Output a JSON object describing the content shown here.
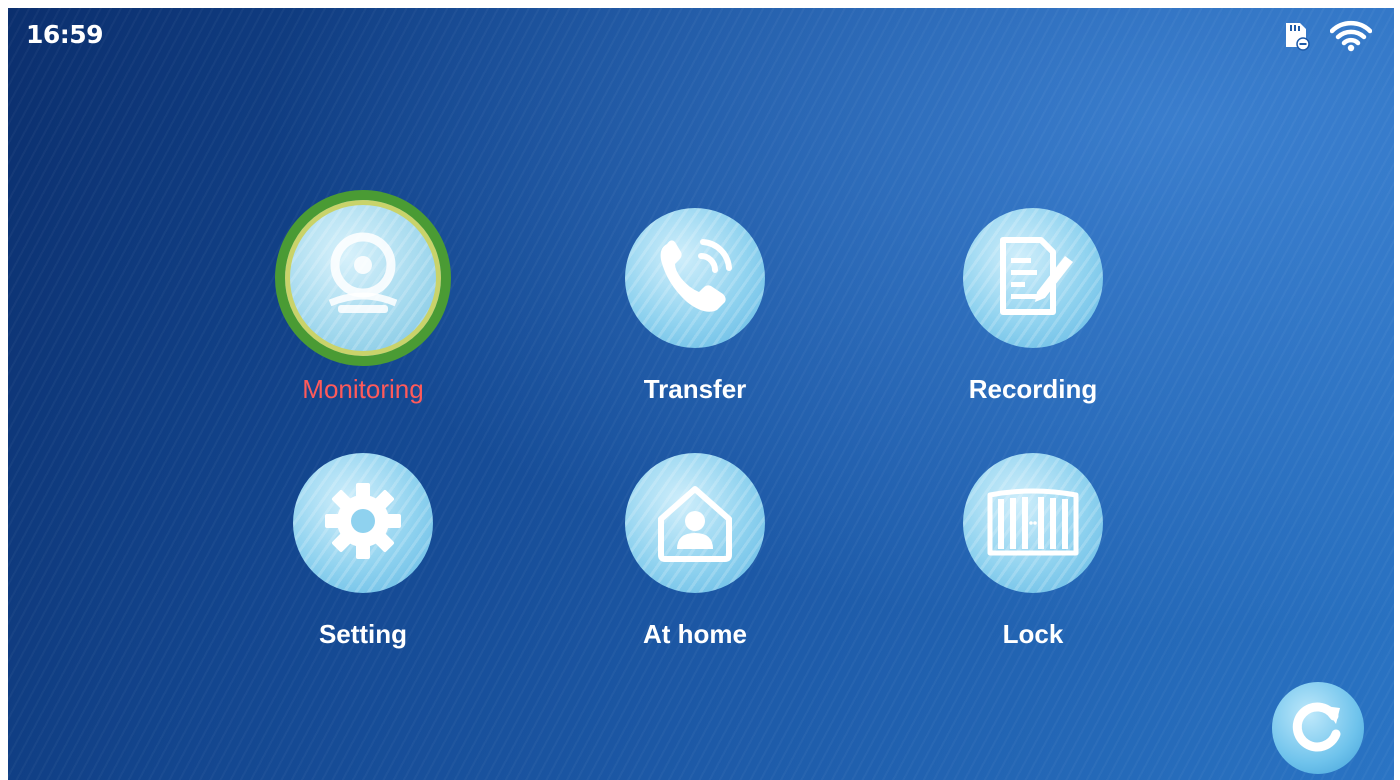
{
  "status": {
    "time": "16:59",
    "icons": [
      "sd-card-icon",
      "wifi-icon"
    ]
  },
  "menu": {
    "items": [
      {
        "label": "Monitoring",
        "icon": "camera-icon",
        "selected": true
      },
      {
        "label": "Transfer",
        "icon": "phone-call-icon",
        "selected": false
      },
      {
        "label": "Recording",
        "icon": "document-edit-icon",
        "selected": false
      },
      {
        "label": "Setting",
        "icon": "gear-icon",
        "selected": false
      },
      {
        "label": "At home",
        "icon": "home-user-icon",
        "selected": false
      },
      {
        "label": "Lock",
        "icon": "gate-lock-icon",
        "selected": false
      }
    ]
  },
  "footer": {
    "refresh_icon": "refresh-icon"
  },
  "colors": {
    "selected_label": "#ff5a5a",
    "selected_ring": "#4a9b34",
    "icon_fill": "#8fd2ef"
  }
}
